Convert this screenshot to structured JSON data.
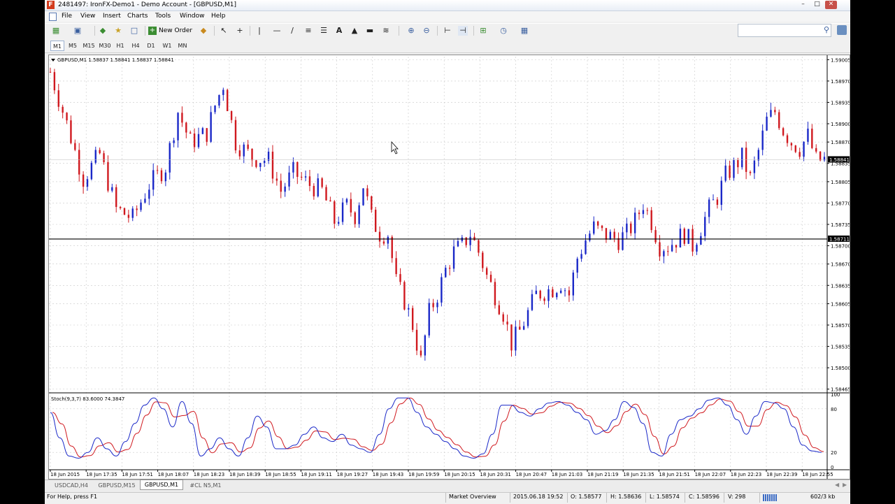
{
  "window": {
    "logo": "F",
    "title": "2481497: IronFX-Demo1 - Demo Account - [GBPUSD,M1]",
    "controls": [
      "–",
      "□",
      "✕"
    ]
  },
  "menu": [
    "File",
    "View",
    "Insert",
    "Charts",
    "Tools",
    "Window",
    "Help"
  ],
  "toolbar": {
    "new_order_label": "New Order",
    "search_placeholder": ""
  },
  "timeframes": [
    "M1",
    "M5",
    "M15",
    "M30",
    "H1",
    "H4",
    "D1",
    "W1",
    "MN"
  ],
  "active_timeframe": "M1",
  "chart": {
    "header": "GBPUSD,M1  1.58837 1.58841 1.58837 1.58841",
    "indicator_label": "Stoch(9,3,7) 83.6000 74.3847",
    "price_badge": "1.58841",
    "line_badge": "1.58711",
    "colors": {
      "up": "#1a28c8",
      "down": "#d0191f",
      "main": "#1a28c8",
      "signal": "#d0191f",
      "grid": "#c8c8c8"
    }
  },
  "chart_data": {
    "type": "candlestick",
    "symbol": "GBPUSD",
    "timeframe": "M1",
    "ohlc_last": {
      "open": 1.58837,
      "high": 1.58841,
      "low": 1.58837,
      "close": 1.58841
    },
    "y_ticks": [
      "1.59005",
      "1.58970",
      "1.58935",
      "1.58900",
      "1.58870",
      "1.58835",
      "1.58805",
      "1.58770",
      "1.58735",
      "1.58700",
      "1.58670",
      "1.58635",
      "1.58605",
      "1.58570",
      "1.58535",
      "1.58500",
      "1.58465"
    ],
    "ylim": [
      1.5846,
      1.5901
    ],
    "x_ticks": [
      "18 Jun 2015",
      "18 Jun 17:35",
      "18 Jun 17:51",
      "18 Jun 18:07",
      "18 Jun 18:23",
      "18 Jun 18:39",
      "18 Jun 18:55",
      "18 Jun 19:11",
      "18 Jun 19:27",
      "18 Jun 19:43",
      "18 Jun 19:59",
      "18 Jun 20:15",
      "18 Jun 20:31",
      "18 Jun 20:47",
      "18 Jun 21:03",
      "18 Jun 21:19",
      "18 Jun 21:35",
      "18 Jun 21:51",
      "18 Jun 22:07",
      "18 Jun 22:23",
      "18 Jun 22:39",
      "18 Jun 22:55"
    ],
    "close_path": [
      [
        0,
        1.58985
      ],
      [
        4,
        1.589
      ],
      [
        8,
        1.5881
      ],
      [
        12,
        1.5885
      ],
      [
        16,
        1.5876
      ],
      [
        20,
        1.58745
      ],
      [
        24,
        1.588
      ],
      [
        28,
        1.5883
      ],
      [
        31,
        1.5892
      ],
      [
        34,
        1.5887
      ],
      [
        38,
        1.58885
      ],
      [
        40,
        1.5893
      ],
      [
        42,
        1.58965
      ],
      [
        45,
        1.5887
      ],
      [
        49,
        1.58845
      ],
      [
        53,
        1.5884
      ],
      [
        56,
        1.5879
      ],
      [
        59,
        1.5882
      ],
      [
        63,
        1.588
      ],
      [
        66,
        1.5879
      ],
      [
        69,
        1.5874
      ],
      [
        72,
        1.58765
      ],
      [
        74,
        1.5875
      ],
      [
        76,
        1.588
      ],
      [
        78,
        1.58745
      ],
      [
        80,
        1.5872
      ],
      [
        82,
        1.5872
      ],
      [
        84,
        1.5864
      ],
      [
        86,
        1.5861
      ],
      [
        88,
        1.5857
      ],
      [
        90,
        1.5851
      ],
      [
        92,
        1.5859
      ],
      [
        94,
        1.5862
      ],
      [
        96,
        1.5866
      ],
      [
        98,
        1.5869
      ],
      [
        100,
        1.587
      ],
      [
        102,
        1.5872
      ],
      [
        104,
        1.5869
      ],
      [
        106,
        1.5865
      ],
      [
        108,
        1.5862
      ],
      [
        110,
        1.5859
      ],
      [
        112,
        1.5854
      ],
      [
        114,
        1.5856
      ],
      [
        116,
        1.5859
      ],
      [
        118,
        1.5862
      ],
      [
        120,
        1.58625
      ],
      [
        122,
        1.5863
      ],
      [
        124,
        1.5864
      ],
      [
        126,
        1.5862
      ],
      [
        128,
        1.5868
      ],
      [
        130,
        1.5871
      ],
      [
        132,
        1.5873
      ],
      [
        134,
        1.5872
      ],
      [
        136,
        1.58715
      ],
      [
        138,
        1.5871
      ],
      [
        140,
        1.5872
      ],
      [
        142,
        1.5874
      ],
      [
        144,
        1.5877
      ],
      [
        146,
        1.5874
      ],
      [
        148,
        1.587
      ],
      [
        150,
        1.587
      ],
      [
        152,
        1.5871
      ],
      [
        154,
        1.5872
      ],
      [
        156,
        1.587
      ],
      [
        158,
        1.5873
      ],
      [
        160,
        1.5876
      ],
      [
        162,
        1.5878
      ],
      [
        164,
        1.58815
      ],
      [
        166,
        1.5883
      ],
      [
        168,
        1.58845
      ],
      [
        170,
        1.5881
      ],
      [
        172,
        1.58855
      ],
      [
        174,
        1.58905
      ],
      [
        176,
        1.5892
      ],
      [
        178,
        1.5889
      ],
      [
        180,
        1.5887
      ],
      [
        182,
        1.5886
      ],
      [
        184,
        1.5888
      ],
      [
        186,
        1.5884
      ],
      [
        188,
        1.58841
      ]
    ],
    "horizontal_line": 1.58711,
    "current_price": 1.58841,
    "indicator": {
      "name": "Stoch(9,3,7)",
      "main": 83.6,
      "signal": 74.3847,
      "ylim": [
        0,
        100
      ],
      "levels": [
        20,
        80
      ],
      "y_ticks": [
        "100",
        "80",
        "20",
        "0"
      ],
      "main_series": [
        75,
        40,
        15,
        12,
        20,
        40,
        25,
        15,
        35,
        60,
        85,
        95,
        80,
        55,
        90,
        60,
        15,
        25,
        40,
        25,
        15,
        40,
        70,
        55,
        25,
        25,
        30,
        45,
        55,
        40,
        35,
        45,
        30,
        25,
        20,
        45,
        80,
        95,
        95,
        75,
        55,
        45,
        35,
        25,
        15,
        12,
        18,
        45,
        85,
        85,
        75,
        70,
        80,
        88,
        90,
        85,
        75,
        65,
        45,
        50,
        65,
        90,
        82,
        60,
        20,
        15,
        45,
        65,
        70,
        80,
        92,
        95,
        85,
        65,
        45,
        70,
        90,
        88,
        80,
        55,
        30,
        22,
        20
      ]
    }
  },
  "tabs": [
    "USDCAD,H4",
    "GBPUSD,M15",
    "GBPUSD,M1",
    "#CL N5,M1"
  ],
  "active_tab": "GBPUSD,M1",
  "status": {
    "help": "For Help, press F1",
    "profile": "Market Overview",
    "datetime": "2015.06.18 19:52",
    "open": "O: 1.58577",
    "high": "H: 1.58636",
    "low": "L: 1.58574",
    "close": "C: 1.58596",
    "volume": "V: 298",
    "traffic": "602/3 kb"
  }
}
